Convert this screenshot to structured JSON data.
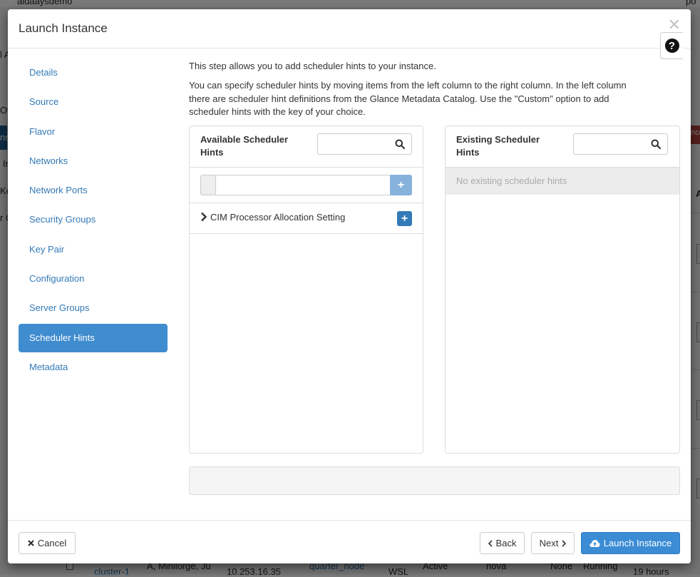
{
  "background": {
    "top_left_text": "aldaaysdemo",
    "top_right_text": "po",
    "side_fragments": [
      "l A",
      "Ov",
      "ns",
      "In",
      "Key",
      "r C"
    ],
    "right_fragments": [
      "nce",
      "A"
    ],
    "row": {
      "name": "cluster-1",
      "image": "A, Minilorge, Ju",
      "ip": "10.253.16.35",
      "flavor": "quarter_node",
      "key": "WSL",
      "status": "Active",
      "az": "nova",
      "task": "None",
      "power": "Running",
      "age": "19 hours"
    }
  },
  "modal": {
    "title": "Launch Instance",
    "close_icon": "close-icon",
    "help_icon": "question-circle-icon",
    "help_label": "?"
  },
  "nav": {
    "items": [
      {
        "label": "Details"
      },
      {
        "label": "Source"
      },
      {
        "label": "Flavor"
      },
      {
        "label": "Networks"
      },
      {
        "label": "Network Ports"
      },
      {
        "label": "Security Groups"
      },
      {
        "label": "Key Pair"
      },
      {
        "label": "Configuration"
      },
      {
        "label": "Server Groups"
      },
      {
        "label": "Scheduler Hints",
        "active": true
      },
      {
        "label": "Metadata"
      }
    ]
  },
  "content": {
    "intro1": "This step allows you to add scheduler hints to your instance.",
    "intro2": "You can specify scheduler hints by moving items from the left column to the right column. In the left column there are scheduler hint definitions from the Glance Metadata Catalog. Use the \"Custom\" option to add scheduler hints with the key of your choice.",
    "available": {
      "title": "Available Scheduler Hints",
      "search_placeholder": "",
      "custom_value": "",
      "custom_add_label": "+",
      "items": [
        {
          "label": "CIM Processor Allocation Setting",
          "add_label": "+"
        }
      ]
    },
    "existing": {
      "title": "Existing Scheduler Hints",
      "search_placeholder": "",
      "empty_text": "No existing scheduler hints"
    }
  },
  "footer": {
    "cancel_label": "Cancel",
    "back_label": "Back",
    "next_label": "Next",
    "launch_label": "Launch Instance"
  },
  "colors": {
    "accent": "#3f8ccf",
    "link": "#337ab7",
    "primary_button": "#3b8cd5"
  }
}
